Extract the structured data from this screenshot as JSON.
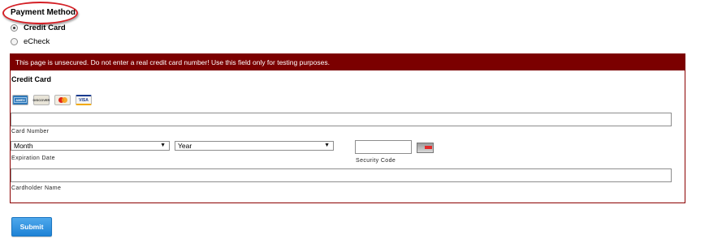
{
  "payment_method": {
    "heading": "Payment Method",
    "options": [
      {
        "label": "Credit Card",
        "selected": true
      },
      {
        "label": "eCheck",
        "selected": false
      }
    ]
  },
  "warning": {
    "text": "This page is unsecured. Do not enter a real credit card number! Use this field only for testing purposes."
  },
  "credit_card": {
    "title": "Credit Card",
    "card_logos": [
      "AMEX",
      "DISCOVER",
      "mastercard",
      "VISA"
    ],
    "card_number": {
      "label": "Card Number",
      "value": ""
    },
    "expiration": {
      "label": "Expiration Date",
      "month": "Month",
      "year": "Year"
    },
    "security_code": {
      "label": "Security Code",
      "value": ""
    },
    "cardholder_name": {
      "label": "Cardholder Name",
      "value": ""
    }
  },
  "submit": {
    "label": "Submit"
  },
  "colors": {
    "banner": "#7b0000",
    "panel_border": "#8b0000",
    "highlight": "#d42026",
    "button": "#2a8fde"
  },
  "icons": [
    "amex-logo-icon",
    "discover-logo-icon",
    "mastercard-logo-icon",
    "visa-logo-icon",
    "cvc-card-icon"
  ]
}
